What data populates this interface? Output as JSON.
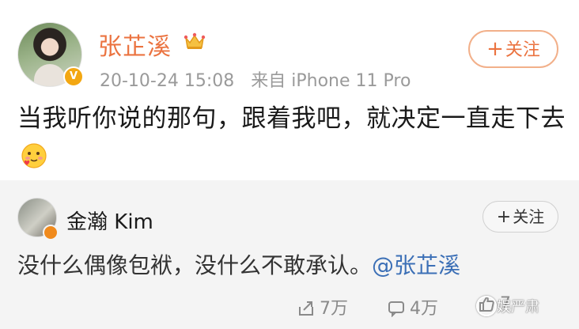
{
  "post": {
    "author": "张芷溪",
    "time": "20-10-24 15:08",
    "source": "来自 iPhone 11 Pro",
    "follow_label": "关注",
    "text": "当我听你说的那句，跟着我吧，就决定一直走下去"
  },
  "repost": {
    "author": "金瀚 Kim",
    "follow_label": "关注",
    "text": "没什么偶像包袱，没什么不敢承认。",
    "mention": "@张芷溪"
  },
  "actions": {
    "share_count": "7万",
    "comment_count": "4万",
    "like_count": "7"
  },
  "watermark": "娱严肃",
  "colors": {
    "accent": "#eb7340",
    "mention": "#3b6fb6",
    "muted": "#9a9a9a",
    "repost_bg": "#f4f4f4"
  }
}
